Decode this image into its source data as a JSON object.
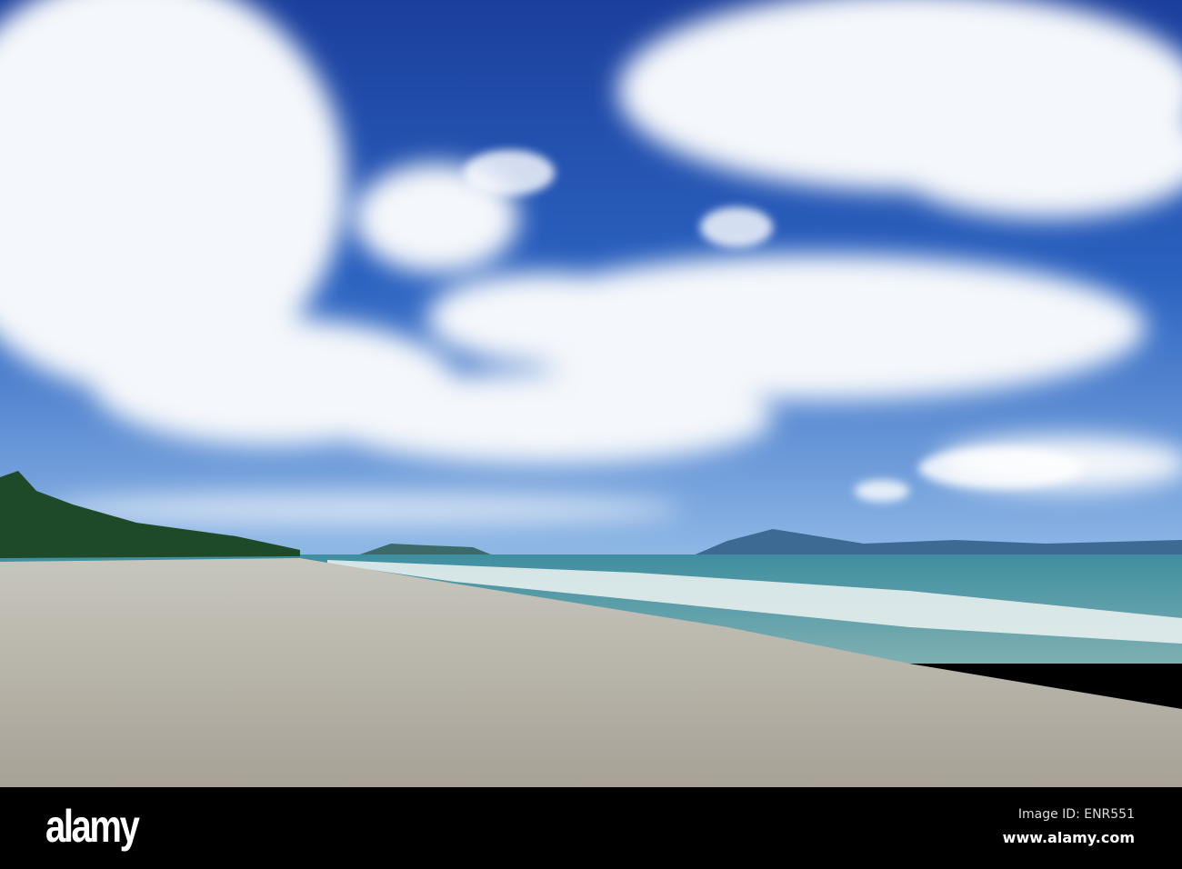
{
  "image": {
    "subject": "beach-seascape",
    "watermark": "alamy"
  },
  "footer": {
    "logo": "alamy",
    "image_id": "Image ID: ENR551",
    "website": "www.alamy.com"
  },
  "colors": {
    "sky_deep": "#1b3f9c",
    "sky_light": "#5b95d8",
    "sea": "#3f8f9c",
    "sand": "#b9b6ab",
    "bar": "#000000"
  }
}
